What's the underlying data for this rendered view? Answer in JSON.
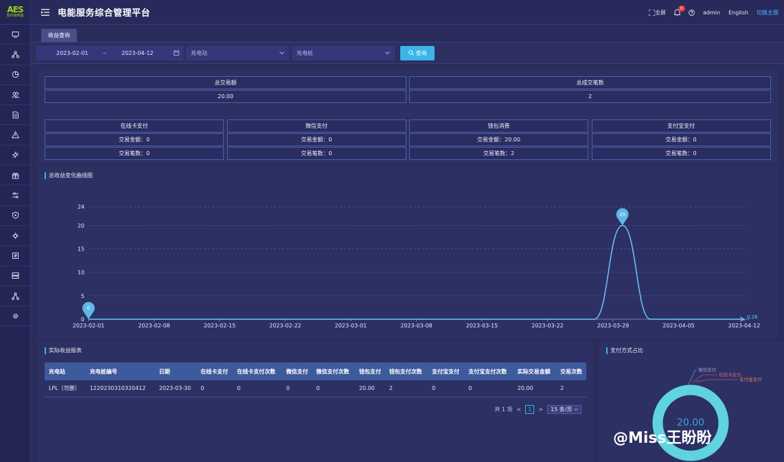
{
  "app": {
    "logo_mark": "AES",
    "logo_text": "安科瑞电能",
    "title": "电能服务综合管理平台"
  },
  "topbar": {
    "fullscreen_label": "全屏",
    "notification_count": "0",
    "user": "admin",
    "language": "English",
    "theme_switch": "切换主题"
  },
  "sidebar": {
    "icons": [
      "monitor-icon",
      "topology-icon",
      "pie-chart-icon",
      "users-icon",
      "document-icon",
      "warning-icon",
      "station-icon",
      "gift-icon",
      "settings-icon",
      "shield-icon",
      "device-icon",
      "chip-icon",
      "storage-icon",
      "network-icon",
      "gear-icon"
    ]
  },
  "tabs": {
    "active": "收益查询"
  },
  "filters": {
    "start_date": "2023-02-01",
    "separator": "~",
    "end_date": "2023-04-12",
    "station_placeholder": "充电站",
    "pile_placeholder": "充电桩",
    "query_label": "查询"
  },
  "summary": {
    "total_amount_label": "总交易额",
    "total_amount_value": "20.00",
    "total_count_label": "总成交笔数",
    "total_count_value": "2",
    "methods": [
      {
        "name": "在线卡支付",
        "amount": "交易金额：0",
        "count": "交易笔数：0"
      },
      {
        "name": "微信支付",
        "amount": "交易金额：0",
        "count": "交易笔数：0"
      },
      {
        "name": "钱包消费",
        "amount": "交易金额：20.00",
        "count": "交易笔数：2"
      },
      {
        "name": "支付宝支付",
        "amount": "交易金额：0",
        "count": "交易笔数：0"
      }
    ]
  },
  "chart": {
    "panel_title": "总收益变化曲线图"
  },
  "chart_data": {
    "type": "line",
    "title": "总收益变化曲线图",
    "x_ticks": [
      "2023-02-01",
      "2023-02-08",
      "2023-02-15",
      "2023-02-22",
      "2023-03-01",
      "2023-03-08",
      "2023-03-15",
      "2023-03-22",
      "2023-03-29",
      "2023-04-05",
      "2023-04-12"
    ],
    "y_ticks": [
      0,
      5,
      10,
      15,
      20,
      24
    ],
    "ylim": [
      0,
      24
    ],
    "series": [
      {
        "points": [
          [
            "2023-02-01",
            0
          ],
          [
            "2023-03-27",
            0
          ],
          [
            "2023-03-30",
            20
          ],
          [
            "2023-04-02",
            0
          ],
          [
            "2023-04-12",
            0
          ]
        ]
      }
    ],
    "markers": [
      {
        "x": "2023-02-01",
        "value": 0,
        "label": "0"
      },
      {
        "x": "2023-03-30",
        "value": 20,
        "label": "20"
      }
    ],
    "end_label": "0.28",
    "grid": true,
    "color": "#6ec6ff"
  },
  "table": {
    "panel_title": "实际收益报表",
    "headers": [
      "充电站",
      "充电桩编号",
      "日期",
      "在线卡支付",
      "在线卡支付次数",
      "微信支付",
      "微信支付次数",
      "钱包支付",
      "钱包支付次数",
      "支付宝支付",
      "支付宝支付次数",
      "实际交易金额",
      "交易次数"
    ],
    "rows": [
      [
        "LPL（勿删）",
        "1220230310320412",
        "2023-03-30",
        "0",
        "0",
        "0",
        "0",
        "20.00",
        "2",
        "0",
        "0",
        "20.00",
        "2"
      ]
    ]
  },
  "pager": {
    "total": "共 1 项",
    "prev": "<",
    "current": "1",
    "next": ">",
    "page_size": "15 条/页"
  },
  "pie": {
    "panel_title": "支付方式占比",
    "legend": [
      "微信支付",
      "在线卡支付",
      "支付宝支付"
    ],
    "center_value": "20.00",
    "ring_color": "#5fd3de"
  },
  "watermark": "@Miss王盼盼"
}
